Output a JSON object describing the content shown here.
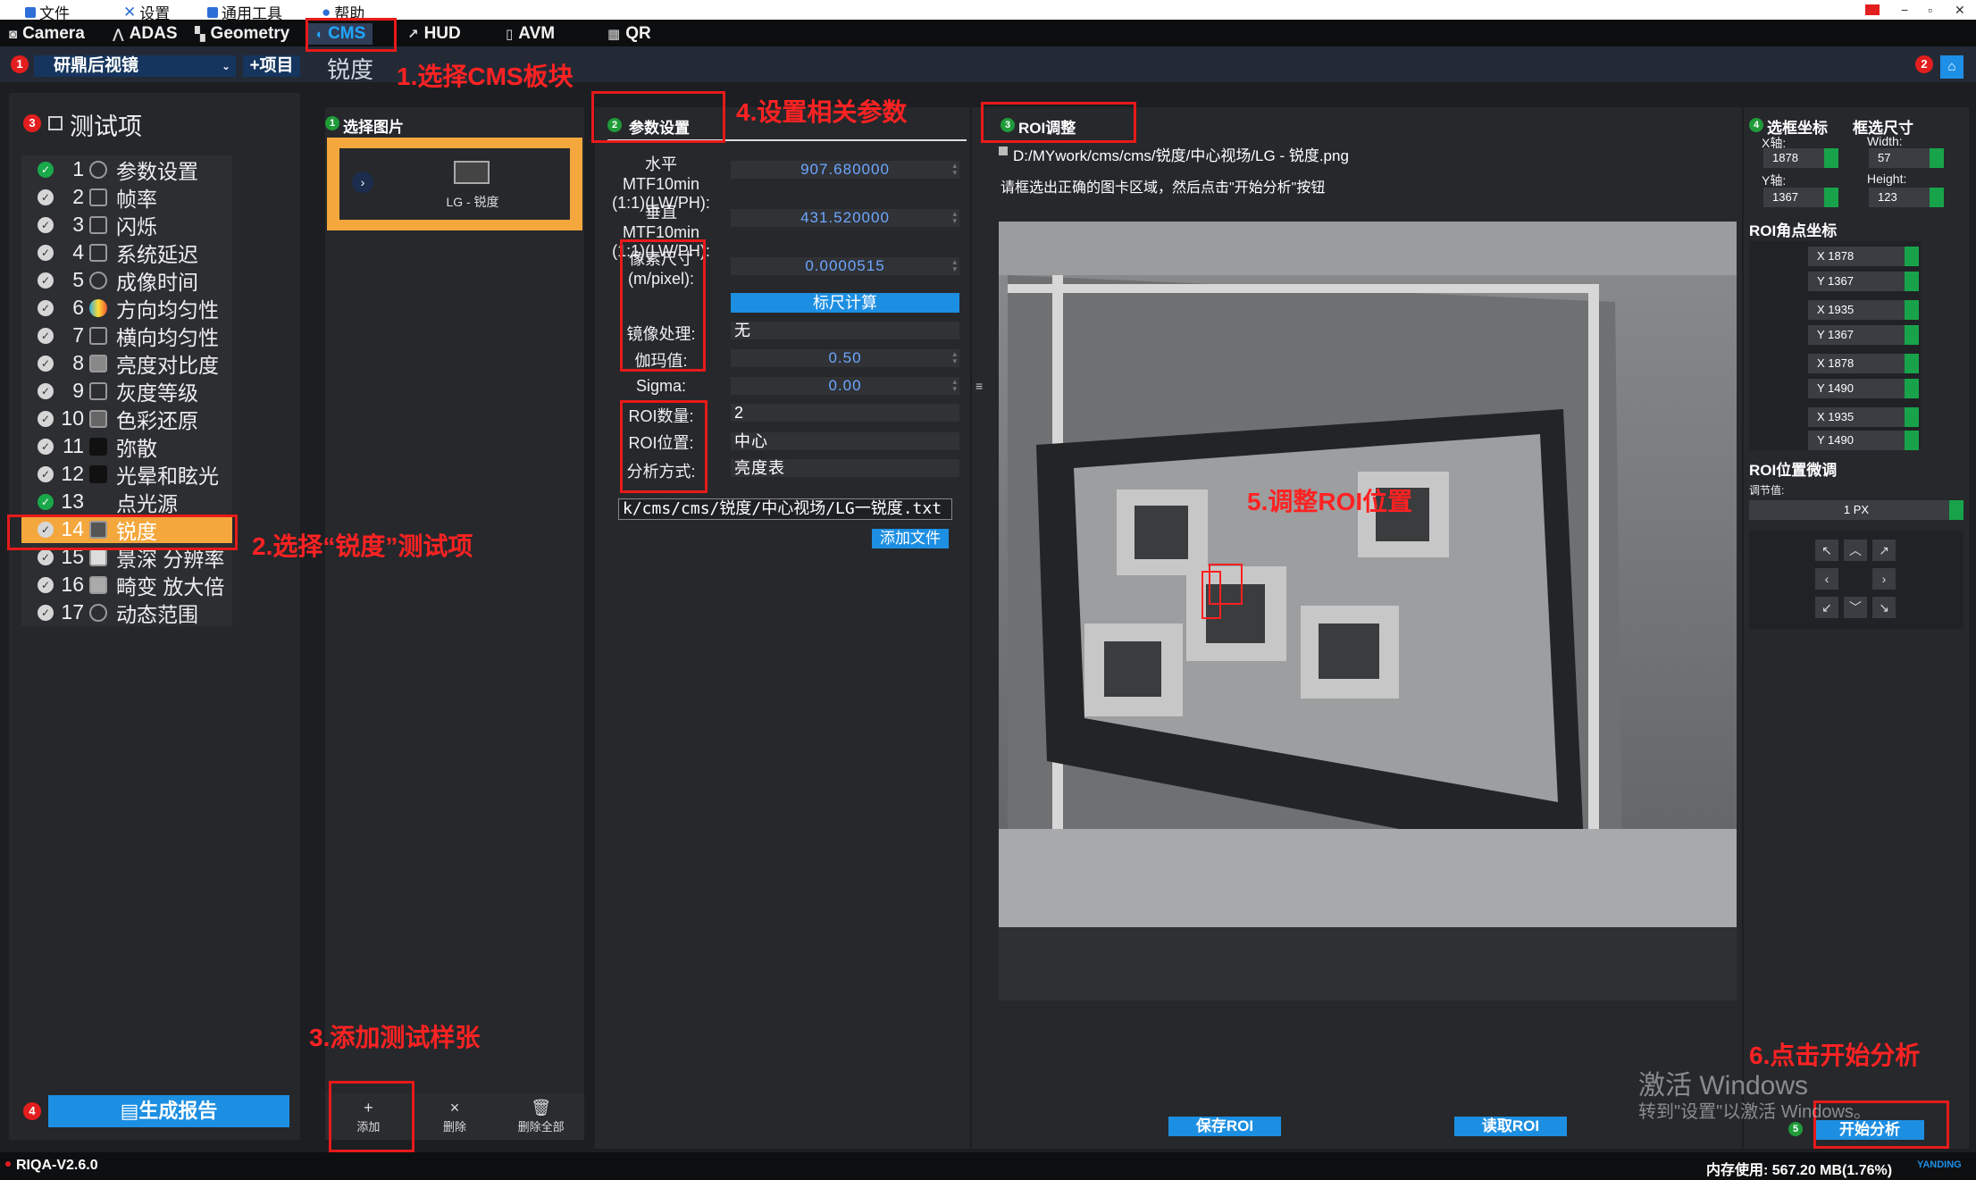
{
  "menu": {
    "file": "文件",
    "settings": "设置",
    "tools": "通用工具",
    "help": "帮助"
  },
  "tabs": [
    {
      "label": "Camera"
    },
    {
      "label": "ADAS"
    },
    {
      "label": "Geometry"
    },
    {
      "label": "CMS"
    },
    {
      "label": "HUD"
    },
    {
      "label": "AVM"
    },
    {
      "label": "QR"
    }
  ],
  "toolbar": {
    "project": "研鼎后视镜",
    "add_project": "+项目",
    "breadcrumb": "锐度"
  },
  "left": {
    "title": "测试项",
    "items": [
      {
        "num": "1",
        "label": "参数设置"
      },
      {
        "num": "2",
        "label": "帧率"
      },
      {
        "num": "3",
        "label": "闪烁"
      },
      {
        "num": "4",
        "label": "系统延迟"
      },
      {
        "num": "5",
        "label": "成像时间"
      },
      {
        "num": "6",
        "label": "方向均匀性"
      },
      {
        "num": "7",
        "label": "横向均匀性"
      },
      {
        "num": "8",
        "label": "亮度对比度"
      },
      {
        "num": "9",
        "label": "灰度等级"
      },
      {
        "num": "10",
        "label": "色彩还原"
      },
      {
        "num": "11",
        "label": "弥散"
      },
      {
        "num": "12",
        "label": "光晕和眩光"
      },
      {
        "num": "13",
        "label": "点光源"
      },
      {
        "num": "14",
        "label": "锐度"
      },
      {
        "num": "15",
        "label": "景深 分辨率"
      },
      {
        "num": "16",
        "label": "畸变 放大倍"
      },
      {
        "num": "17",
        "label": "动态范围"
      }
    ],
    "report_button": "生成报告"
  },
  "images": {
    "title": "选择图片",
    "card_label": "LG - 锐度",
    "add": "添加",
    "delete": "删除",
    "delete_all": "删除全部"
  },
  "params": {
    "title": "参数设置",
    "h_mtf_label": "水平MTF10min (1:1)(LW/PH):",
    "h_mtf_value": "907.680000",
    "v_mtf_label": "垂直MTF10min (1:1)(LW/PH):",
    "v_mtf_value": "431.520000",
    "pixel_label": "像素尺寸 (m/pixel):",
    "pixel_value": "0.0000515",
    "scale_button": "标尺计算",
    "mirror_label": "镜像处理:",
    "mirror_value": "无",
    "gamma_label": "伽玛值:",
    "gamma_value": "0.50",
    "sigma_label": "Sigma:",
    "sigma_value": "0.00",
    "roi_count_label": "ROI数量:",
    "roi_count_value": "2",
    "roi_pos_label": "ROI位置:",
    "roi_pos_value": "中心",
    "method_label": "分析方式:",
    "method_value": "亮度表",
    "file_path": "k/cms/cms/锐度/中心视场/LG一锐度.txt",
    "add_file": "添加文件"
  },
  "roi": {
    "title": "ROI调整",
    "path": "D:/MYwork/cms/cms/锐度/中心视场/LG - 锐度.png",
    "hint": "请框选出正确的图卡区域，然后点击\"开始分析\"按钮",
    "save": "保存ROI",
    "read": "读取ROI"
  },
  "right": {
    "coord_title": "选框坐标",
    "size_title": "框选尺寸",
    "x_label": "X轴:",
    "x_value": "1878",
    "y_label": "Y轴:",
    "y_value": "1367",
    "w_label": "Width:",
    "w_value": "57",
    "h_label": "Height:",
    "h_value": "123",
    "corner_title": "ROI角点坐标",
    "corners": [
      {
        "x": "X 1878",
        "y": "Y 1367"
      },
      {
        "x": "X 1935",
        "y": "Y 1367"
      },
      {
        "x": "X 1878",
        "y": "Y 1490"
      },
      {
        "x": "X 1935",
        "y": "Y 1490"
      }
    ],
    "fine_title": "ROI位置微调",
    "step_label": "调节值:",
    "step_value": "1 PX",
    "start": "开始分析"
  },
  "annotations": {
    "a1": "1.选择CMS板块",
    "a2": "2.选择“锐度”测试项",
    "a3": "3.添加测试样张",
    "a4": "4.设置相关参数",
    "a5": "5.调整ROI位置",
    "a6": "6.点击开始分析"
  },
  "watermark": {
    "line1": "激活 Windows",
    "line2": "转到\"设置\"以激活 Windows。"
  },
  "status": {
    "version": "RIQA-V2.6.0",
    "memory": "内存使用: 567.20 MB(1.76%)",
    "brand": "YANDING"
  },
  "colors": {
    "accent": "#1d8fe2",
    "selected": "#f4a73c",
    "annotation": "#e81a1a"
  }
}
